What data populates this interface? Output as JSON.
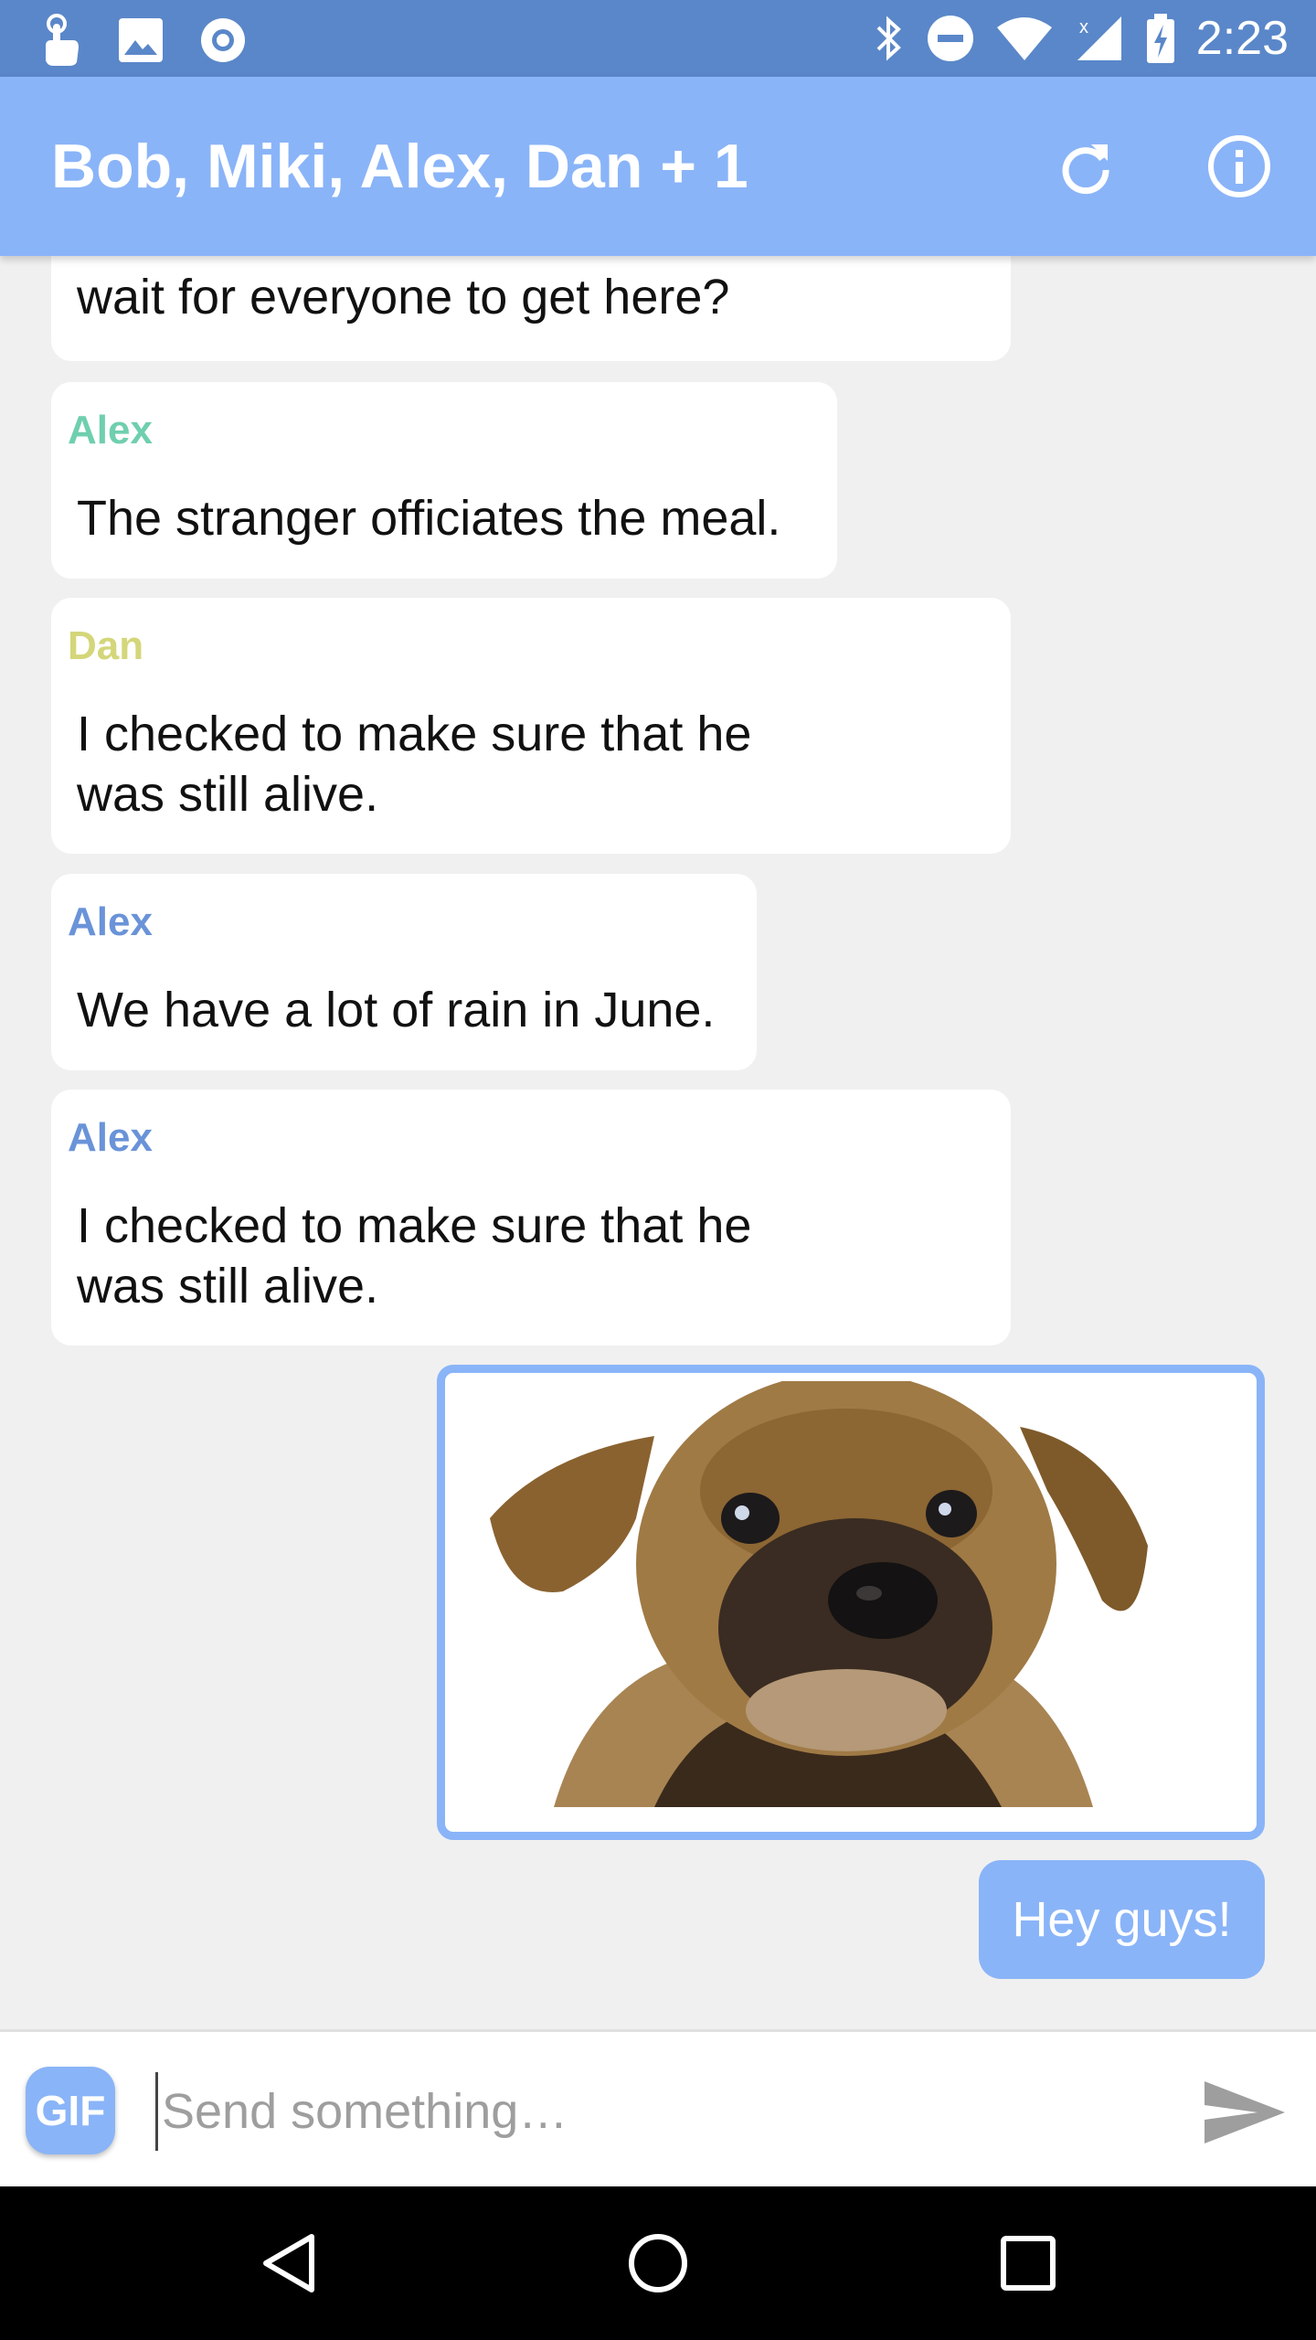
{
  "status_bar": {
    "time": "2:23",
    "left_icons": [
      "touch-icon",
      "image-icon",
      "sync-circle-icon"
    ],
    "right_icons": [
      "bluetooth-icon",
      "do-not-disturb-icon",
      "wifi-icon",
      "cell-signal-icon",
      "battery-charging-icon"
    ]
  },
  "app_bar": {
    "title": "Bob, Miki, Alex, Dan + 1",
    "actions": [
      "refresh-icon",
      "info-icon"
    ]
  },
  "messages": [
    {
      "sender": "",
      "text": "wait for everyone to get here?"
    },
    {
      "sender": "Alex",
      "sender_color": "#6fcfae",
      "text": "The stranger officiates the meal."
    },
    {
      "sender": "Dan",
      "sender_color": "#d4d67a",
      "line1": "I checked to make sure that he",
      "line2": "was still alive."
    },
    {
      "sender": "Alex",
      "sender_color": "#6a93d8",
      "text": "We have a lot of rain in June."
    },
    {
      "sender": "Alex",
      "sender_color": "#6a93d8",
      "line1": "I checked to make sure that he",
      "line2": "was still alive."
    }
  ],
  "outgoing": {
    "image_subject": "puppy-image",
    "text": "Hey guys!"
  },
  "composer": {
    "gif_label": "GIF",
    "placeholder": "Send something…",
    "send_icon": "send-icon"
  },
  "nav_bar": [
    "back-icon",
    "home-icon",
    "recents-icon"
  ],
  "colors": {
    "status_bar": "#5a87c9",
    "app_bar": "#8ab4f8",
    "accent": "#8ab4f8"
  }
}
